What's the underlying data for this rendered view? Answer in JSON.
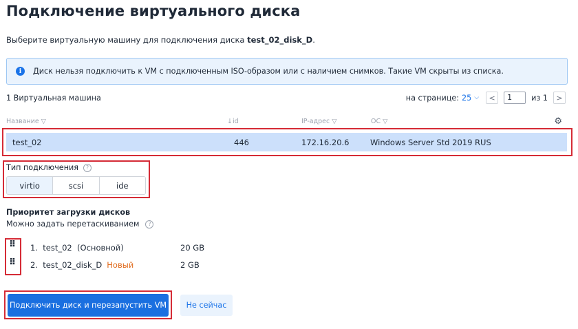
{
  "page": {
    "title": "Подключение виртуального диска",
    "subtitle_prefix": "Выберите виртуальную машину для подключения диска ",
    "disk_name": "test_02_disk_D",
    "subtitle_suffix": "."
  },
  "alert": {
    "text": "Диск нельзя подключить к VM с подключенным ISO-образом или с наличием снимков. Такие VM скрыты из списка."
  },
  "table": {
    "count_label": "1 Виртуальная машина",
    "pager": {
      "per_page_label": "на странице:",
      "per_page_value": "25",
      "prev": "<",
      "current_page": "1",
      "of_label": "из 1",
      "next": ">"
    },
    "columns": {
      "name": "Название ▽",
      "id": "↓id",
      "ip": "IP-адрес ▽",
      "os": "ОС ▽"
    },
    "rows": [
      {
        "name": "test_02",
        "id": "446",
        "ip": "172.16.20.6",
        "os": "Windows Server Std 2019 RUS"
      }
    ]
  },
  "connection": {
    "label": "Тип подключения",
    "options": [
      "virtio",
      "scsi",
      "ide"
    ],
    "selected": "virtio"
  },
  "boot_priority": {
    "title": "Приоритет загрузки дисков",
    "hint": "Можно задать перетаскиванием",
    "disks": [
      {
        "label": "1.  test_02  (Основной)",
        "badge": "",
        "size": "20 GB"
      },
      {
        "label": "2.  test_02_disk_D",
        "badge": "Новый",
        "size": "2 GB"
      }
    ]
  },
  "actions": {
    "primary": "Подключить диск и перезапустить VM",
    "secondary": "Не сейчас"
  },
  "colors": {
    "accent": "#1a6fe0",
    "highlight_row": "#cce0fb",
    "annotation_red": "#d52b36",
    "new_badge": "#e06a1b"
  }
}
